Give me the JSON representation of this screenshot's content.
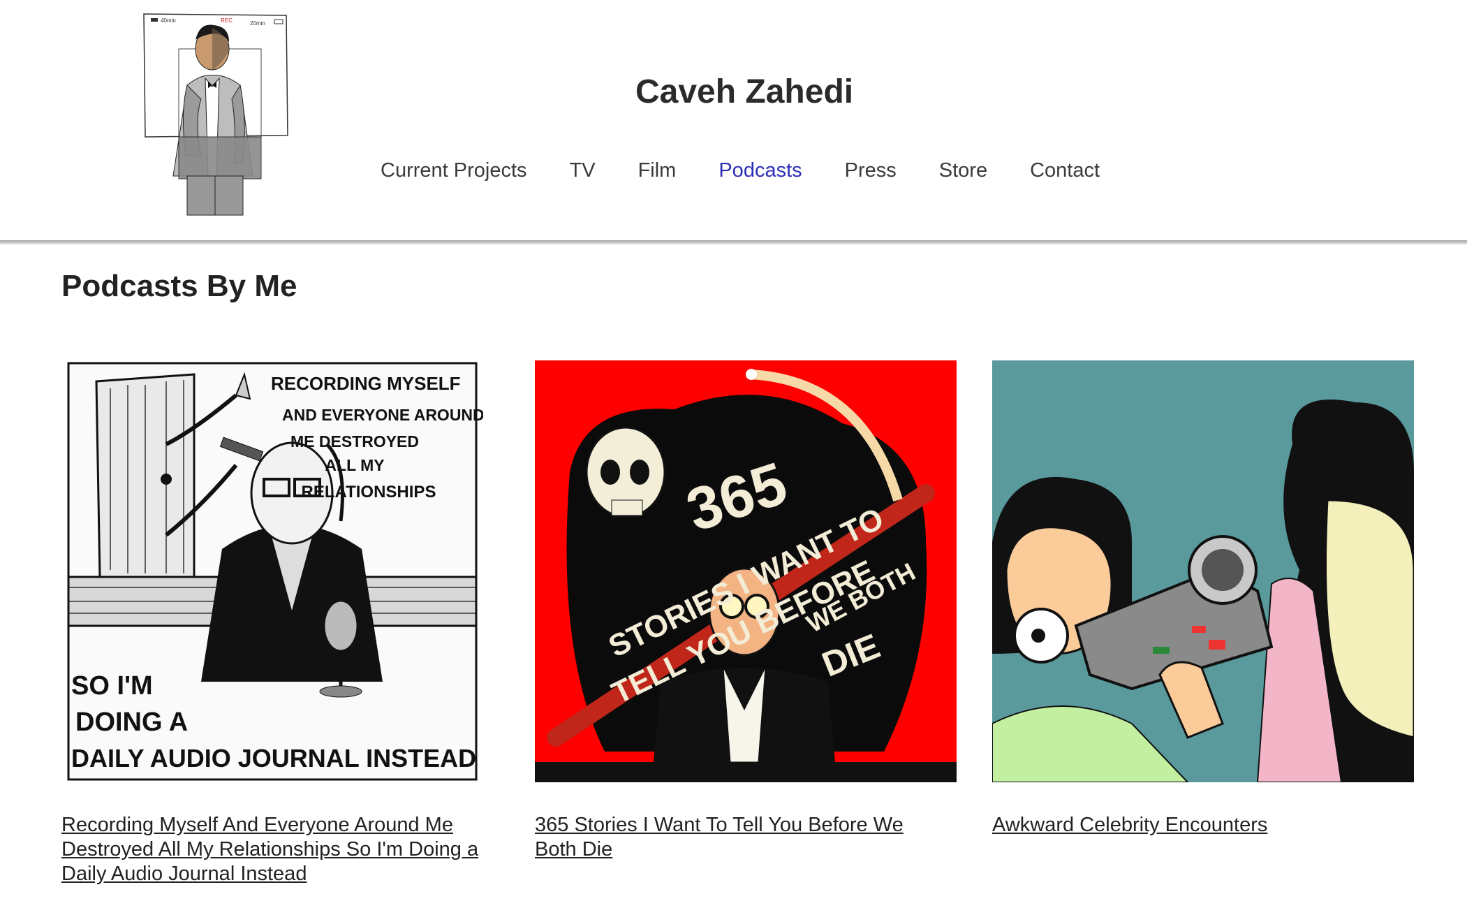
{
  "header": {
    "site_title": "Caveh Zahedi",
    "logo_texts": {
      "left": "40min",
      "center": "REC",
      "right": "20min"
    }
  },
  "nav": {
    "items": [
      {
        "label": "Current Projects",
        "active": false
      },
      {
        "label": "TV",
        "active": false
      },
      {
        "label": "Film",
        "active": false
      },
      {
        "label": "Podcasts",
        "active": true
      },
      {
        "label": "Press",
        "active": false
      },
      {
        "label": "Store",
        "active": false
      },
      {
        "label": "Contact",
        "active": false
      }
    ],
    "active_color": "#2d2fb3"
  },
  "main": {
    "section_title": "Podcasts By Me",
    "podcasts": [
      {
        "title": "Recording Myself And Everyone Around Me Destroyed All My Relationships So I'm Doing a Daily Audio Journal Instead",
        "art_text": {
          "top": [
            "RECORDING MYSELF",
            "AND EVERYONE AROUND",
            "ME DESTROYED",
            "ALL MY",
            "RELATIONSHIPS"
          ],
          "bottom": [
            "SO I'M",
            "DOING A",
            "DAILY AUDIO JOURNAL INSTEAD"
          ]
        }
      },
      {
        "title": "365 Stories I Want To Tell You Before We Both Die",
        "art_text": {
          "number": "365",
          "lines": [
            "STORIES I WANT TO",
            "TELL YOU BEFORE",
            "WE BOTH",
            "DIE"
          ]
        },
        "background": "#ff0000"
      },
      {
        "title": "Awkward Celebrity Encounters",
        "background": "#5a9a9c"
      }
    ]
  }
}
